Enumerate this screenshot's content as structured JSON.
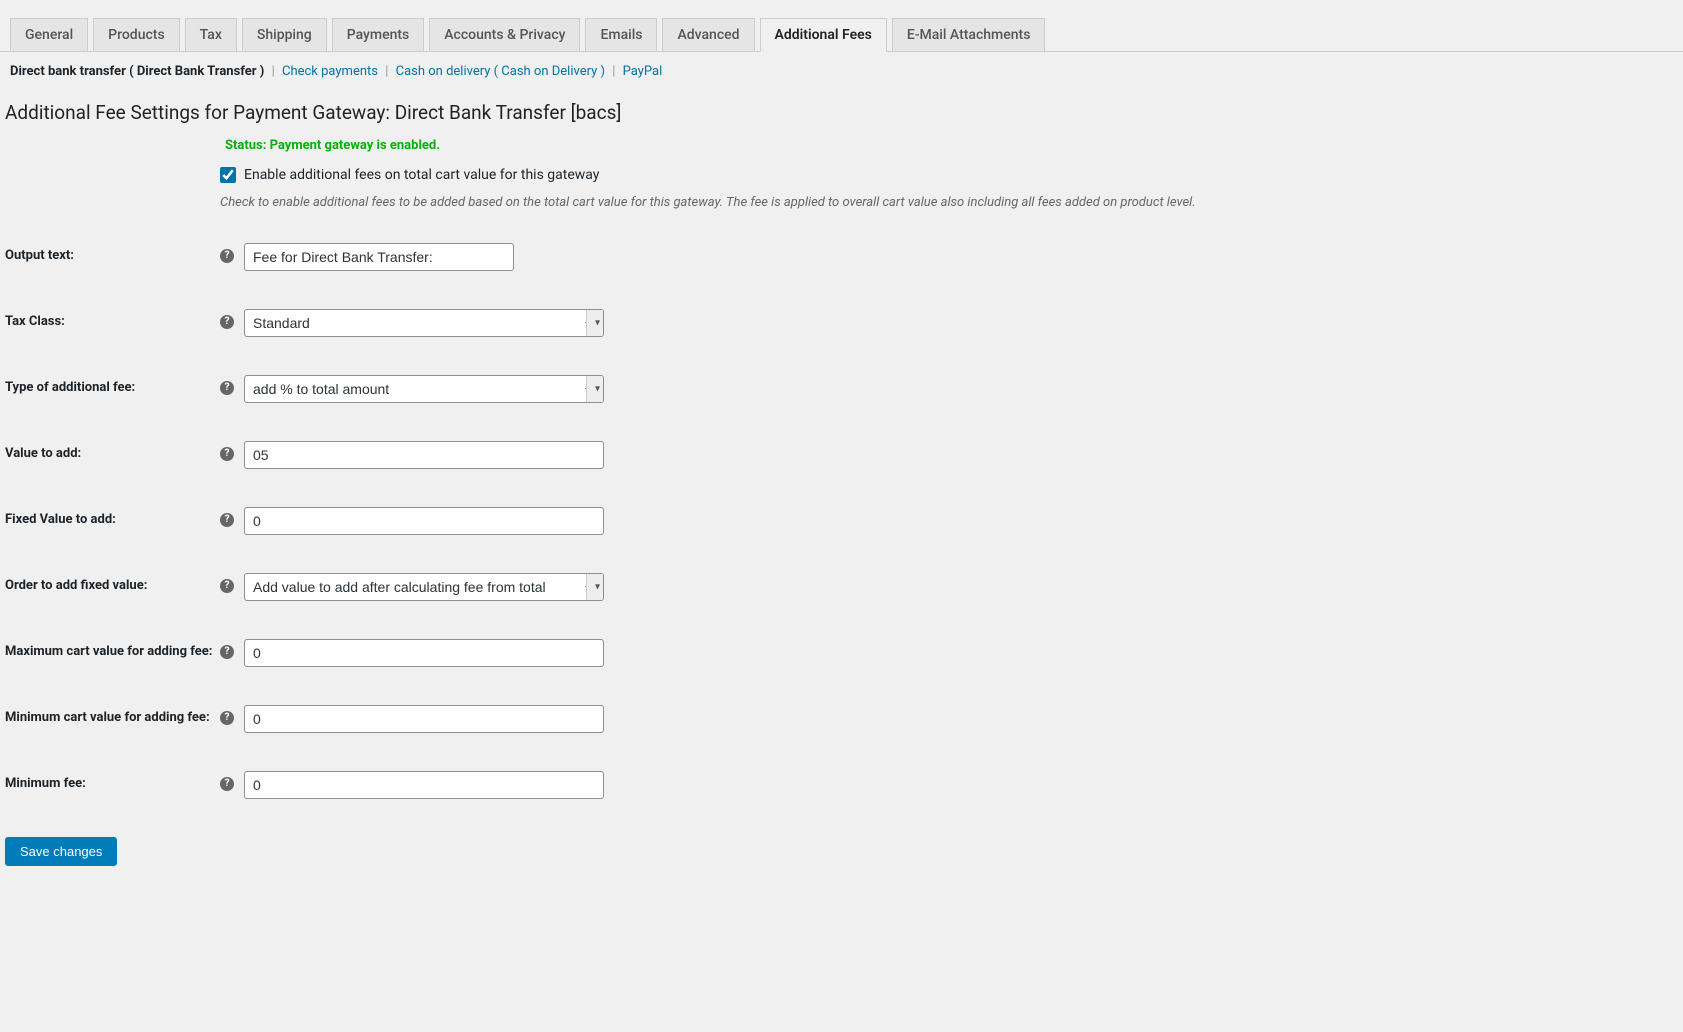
{
  "tabs": [
    {
      "label": "General"
    },
    {
      "label": "Products"
    },
    {
      "label": "Tax"
    },
    {
      "label": "Shipping"
    },
    {
      "label": "Payments"
    },
    {
      "label": "Accounts & Privacy"
    },
    {
      "label": "Emails"
    },
    {
      "label": "Advanced"
    },
    {
      "label": "Additional Fees",
      "active": true
    },
    {
      "label": "E-Mail Attachments"
    }
  ],
  "subnav": {
    "active": "Direct bank transfer ( Direct Bank Transfer )",
    "links": [
      {
        "label": "Check payments"
      },
      {
        "label": "Cash on delivery ( Cash on Delivery )"
      },
      {
        "label": "PayPal"
      }
    ]
  },
  "section_title": "Additional Fee Settings for Payment Gateway: Direct Bank Transfer [bacs]",
  "status": "Status: Payment gateway is enabled.",
  "enable": {
    "label": "Enable additional fees on total cart value for this gateway",
    "checked": true,
    "description": "Check to enable additional fees to be added based on the total cart value for this gateway. The fee is applied to overall cart value also including all fees added on product level."
  },
  "fields": {
    "output_text": {
      "label": "Output text:",
      "value": "Fee for Direct Bank Transfer:"
    },
    "tax_class": {
      "label": "Tax Class:",
      "value": "Standard"
    },
    "fee_type": {
      "label": "Type of additional fee:",
      "value": "add % to total amount"
    },
    "value_to_add": {
      "label": "Value to add:",
      "value": "05"
    },
    "fixed_value": {
      "label": "Fixed Value to add:",
      "value": "0"
    },
    "order_fixed": {
      "label": "Order to add fixed value:",
      "value": "Add value to add after calculating fee from total"
    },
    "max_cart": {
      "label": "Maximum cart value for adding fee:",
      "value": "0"
    },
    "min_cart": {
      "label": "Minimum cart value for adding fee:",
      "value": "0"
    },
    "min_fee": {
      "label": "Minimum fee:",
      "value": "0"
    }
  },
  "save_button": "Save changes"
}
